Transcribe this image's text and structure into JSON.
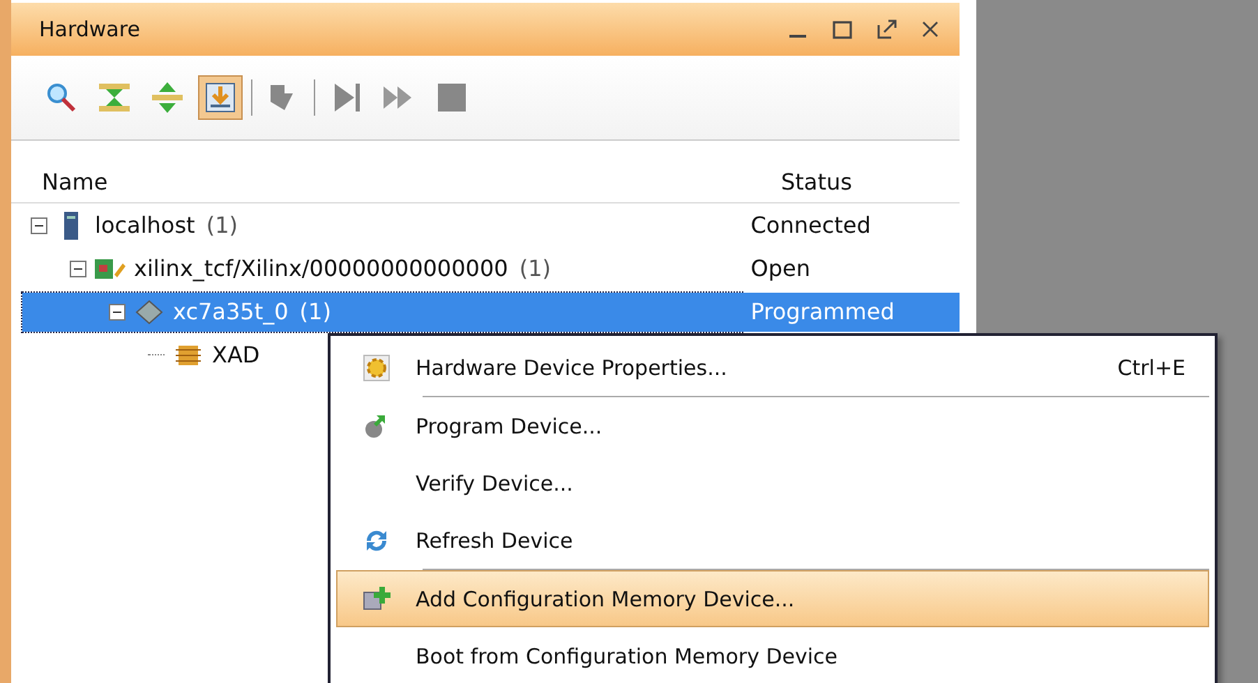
{
  "panel": {
    "title": "Hardware"
  },
  "toolbar": [
    {
      "kind": "search",
      "selected": false
    },
    {
      "kind": "collapse",
      "selected": false
    },
    {
      "kind": "expand",
      "selected": false
    },
    {
      "kind": "autoconnect",
      "selected": true
    },
    {
      "kind": "sep"
    },
    {
      "kind": "download",
      "selected": false
    },
    {
      "kind": "sep"
    },
    {
      "kind": "step",
      "selected": false
    },
    {
      "kind": "run",
      "selected": false
    },
    {
      "kind": "stop",
      "selected": false
    }
  ],
  "table": {
    "columns": [
      "Name",
      "Status"
    ],
    "rows": [
      {
        "kind": "server",
        "name": "localhost",
        "count": "(1)",
        "status": "Connected",
        "selected": false,
        "expanded": true,
        "children": [
          {
            "kind": "cable",
            "name": "xilinx_tcf/Xilinx/00000000000000",
            "count": "(1)",
            "status": "Open",
            "selected": false,
            "expanded": true,
            "children": [
              {
                "kind": "chip",
                "name": "xc7a35t_0",
                "count": "(1)",
                "status": "Programmed",
                "selected": true,
                "expanded": true,
                "children": [
                  {
                    "kind": "xadc",
                    "name": "XAD",
                    "selected": false
                  }
                ]
              }
            ]
          }
        ]
      }
    ]
  },
  "context_menu": {
    "items": [
      {
        "kind": "properties",
        "label": "Hardware Device Properties...",
        "shortcut": "Ctrl+E",
        "selected": false,
        "separator_after": true
      },
      {
        "kind": "program",
        "label": "Program Device...",
        "selected": false
      },
      {
        "kind": "verify",
        "label": "Verify Device...",
        "selected": false
      },
      {
        "kind": "refresh",
        "label": "Refresh Device",
        "selected": false,
        "separator_after": true
      },
      {
        "kind": "add_memory",
        "label": "Add Configuration Memory Device...",
        "selected": true
      },
      {
        "kind": "boot",
        "label": "Boot from Configuration Memory Device",
        "selected": false
      }
    ]
  }
}
